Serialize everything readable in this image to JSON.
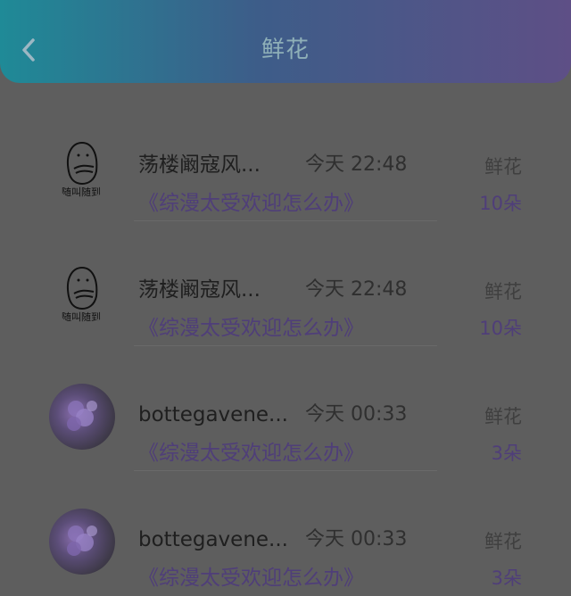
{
  "header": {
    "title": "鲜花",
    "back_icon": "chevron-left-icon"
  },
  "list": [
    {
      "avatar": "sketch",
      "avatar_caption": "随叫随到",
      "name": "荡楼阚寇风...",
      "time": "今天 22:48",
      "type": "鲜花",
      "book": "《综漫太受欢迎怎么办》",
      "count": "10朵"
    },
    {
      "avatar": "sketch",
      "avatar_caption": "随叫随到",
      "name": "荡楼阚寇风...",
      "time": "今天 22:48",
      "type": "鲜花",
      "book": "《综漫太受欢迎怎么办》",
      "count": "10朵"
    },
    {
      "avatar": "photo",
      "name": "bottegavene...",
      "time": "今天 00:33",
      "type": "鲜花",
      "book": "《综漫太受欢迎怎么办》",
      "count": "3朵"
    },
    {
      "avatar": "photo",
      "name": "bottegavene...",
      "time": "今天 00:33",
      "type": "鲜花",
      "book": "《综漫太受欢迎怎么办》",
      "count": "3朵"
    }
  ]
}
